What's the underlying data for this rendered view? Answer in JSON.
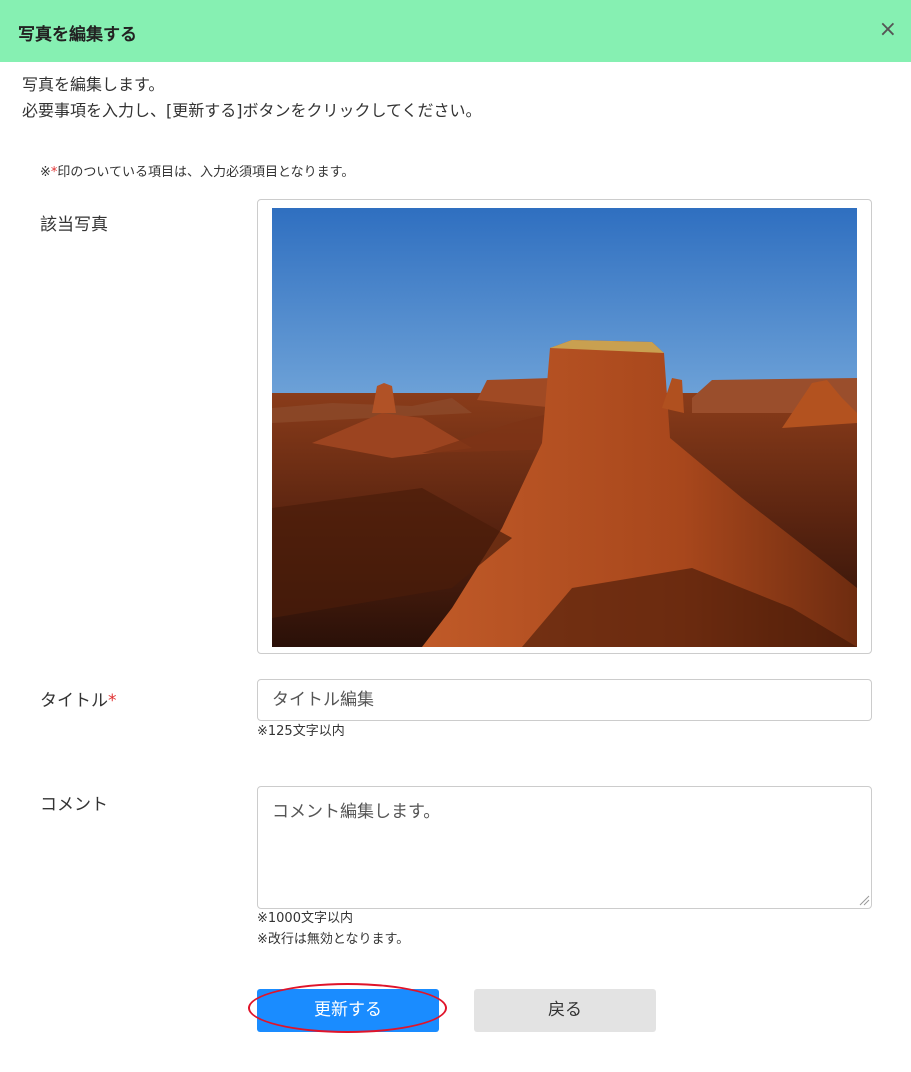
{
  "dialog": {
    "title": "写真を編集する",
    "close_label": "×"
  },
  "intro": {
    "line1": "写真を編集します。",
    "line2": "必要事項を入力し、[更新する]ボタンをクリックしてください。"
  },
  "note": {
    "prefix": "※",
    "star": "*",
    "text": "印のついている項目は、入力必須項目となります。"
  },
  "photo": {
    "label": "該当写真",
    "content": "desert butte landscape under blue sky"
  },
  "title_field": {
    "label": "タイトル",
    "required_mark": "*",
    "value": "タイトル編集",
    "help": "※125文字以内"
  },
  "comment_field": {
    "label": "コメント",
    "value": "コメント編集します。",
    "help1": "※1000文字以内",
    "help2": "※改行は無効となります。"
  },
  "buttons": {
    "update": "更新する",
    "back": "戻る"
  },
  "colors": {
    "header_bg": "#86f0b2",
    "primary_button": "#1a8cff",
    "highlight_ring": "#e0142a",
    "required": "#e03030"
  }
}
